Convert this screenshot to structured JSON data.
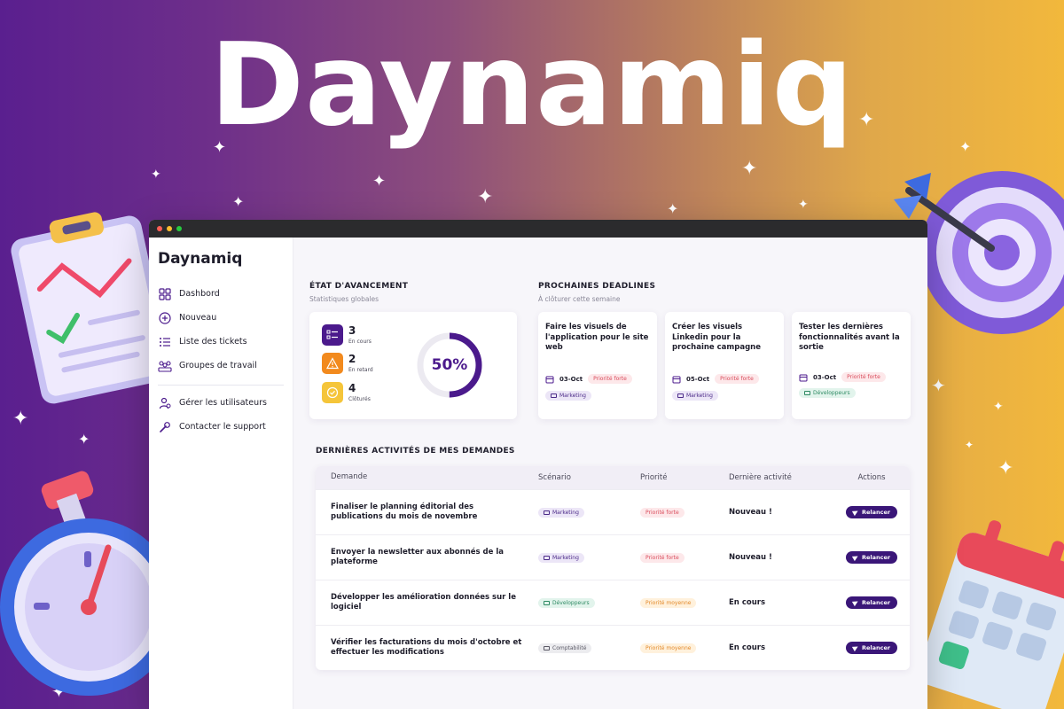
{
  "hero": {
    "title": "Daynamiq"
  },
  "sidebar": {
    "logo": "Daynamiq",
    "items": [
      {
        "label": "Dashbord",
        "icon": "dashboard-icon"
      },
      {
        "label": "Nouveau",
        "icon": "plus-circle-icon"
      },
      {
        "label": "Liste des tickets",
        "icon": "list-icon"
      },
      {
        "label": "Groupes de travail",
        "icon": "group-icon"
      }
    ],
    "bottom_items": [
      {
        "label": "Gérer les utilisateurs",
        "icon": "users-icon"
      },
      {
        "label": "Contacter le support",
        "icon": "wrench-icon"
      }
    ]
  },
  "status": {
    "title": "ÉTAT D'AVANCEMENT",
    "subtitle": "Statistiques globales",
    "stats": [
      {
        "value": "3",
        "label": "En cours",
        "color": "#4b1a8c",
        "icon": "list-check-icon"
      },
      {
        "value": "2",
        "label": "En retard",
        "color": "#f28a1e",
        "icon": "warning-icon"
      },
      {
        "value": "4",
        "label": "Clôturés",
        "color": "#f5c53a",
        "icon": "check-circle-icon"
      }
    ],
    "progress_label": "50%",
    "progress": 0.5
  },
  "deadlines": {
    "title": "PROCHAINES DEADLINES",
    "subtitle": "À clôturer cette semaine",
    "cards": [
      {
        "title": "Faire les visuels de l'application pour le site web",
        "date": "03-Oct",
        "priority": "Priorité forte",
        "tag": "Marketing"
      },
      {
        "title": "Créer les visuels Linkedin pour la prochaine campagne",
        "date": "05-Oct",
        "priority": "Priorité forte",
        "tag": "Marketing"
      },
      {
        "title": "Tester les dernières fonctionnalités avant la sortie",
        "date": "03-Oct",
        "priority": "Priorité forte",
        "tag": "Développeurs"
      }
    ]
  },
  "activities": {
    "title": "DERNIÈRES ACTIVITÉS DE MES DEMANDES",
    "columns": [
      "Demande",
      "Scénario",
      "Priorité",
      "Dernière activité",
      "Actions"
    ],
    "rows": [
      {
        "demande": "Finaliser le planning éditorial des publications du mois de novembre",
        "scenario": "Marketing",
        "priority": "Priorité forte",
        "activity": "Nouveau !",
        "action": "Relancer"
      },
      {
        "demande": "Envoyer la newsletter aux abonnés de la plateforme",
        "scenario": "Marketing",
        "priority": "Priorité forte",
        "activity": "Nouveau !",
        "action": "Relancer"
      },
      {
        "demande": "Développer les amélioration données sur le logiciel",
        "scenario": "Développeurs",
        "priority": "Priorité moyenne",
        "activity": "En cours",
        "action": "Relancer"
      },
      {
        "demande": "Vérifier les facturations du mois d'octobre et effectuer les modifications",
        "scenario": "Comptabilité",
        "priority": "Priorité moyenne",
        "activity": "En cours",
        "action": "Relancer"
      }
    ]
  },
  "colors": {
    "brand": "#3a1678",
    "accent": "#4b1a8c"
  }
}
